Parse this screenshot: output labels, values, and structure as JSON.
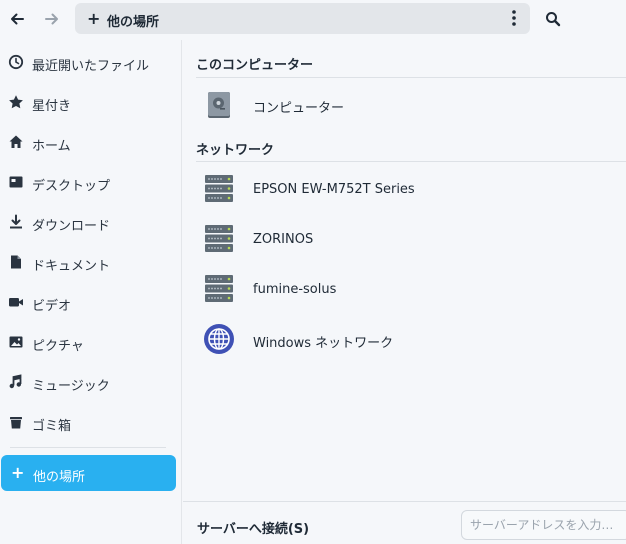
{
  "header": {
    "back_icon": "arrow-left-icon",
    "forward_icon": "arrow-right-icon",
    "path_icon": "plus-icon",
    "path_label": "他の場所",
    "menu_icon": "vertical-dots-icon",
    "search_icon": "search-icon"
  },
  "sidebar": {
    "items": [
      {
        "label": "最近開いたファイル",
        "icon": "clock-icon"
      },
      {
        "label": "星付き",
        "icon": "star-icon"
      },
      {
        "label": "ホーム",
        "icon": "home-icon"
      },
      {
        "label": "デスクトップ",
        "icon": "desktop-icon"
      },
      {
        "label": "ダウンロード",
        "icon": "download-icon"
      },
      {
        "label": "ドキュメント",
        "icon": "document-icon"
      },
      {
        "label": "ビデオ",
        "icon": "video-icon"
      },
      {
        "label": "ピクチャ",
        "icon": "picture-icon"
      },
      {
        "label": "ミュージック",
        "icon": "music-icon"
      },
      {
        "label": "ゴミ箱",
        "icon": "trash-icon"
      }
    ],
    "active": {
      "label": "他の場所",
      "icon": "plus-icon"
    }
  },
  "main": {
    "this_computer_title": "このコンピューター",
    "computer_label": "コンピューター",
    "network_title": "ネットワーク",
    "network_items": [
      {
        "label": "EPSON EW-M752T Series",
        "icon": "server-icon"
      },
      {
        "label": "ZORINOS",
        "icon": "server-icon"
      },
      {
        "label": "fumine-solus",
        "icon": "server-icon"
      },
      {
        "label": "Windows ネットワーク",
        "icon": "globe-icon"
      }
    ]
  },
  "bottom": {
    "connect_label": "サーバーへ接続(S)",
    "address_placeholder": "サーバーアドレスを入力…"
  },
  "colors": {
    "accent": "#29b0f0",
    "background": "#f5f7fa",
    "pathbar": "#e3e6ea",
    "globe": "#3f51b5"
  }
}
